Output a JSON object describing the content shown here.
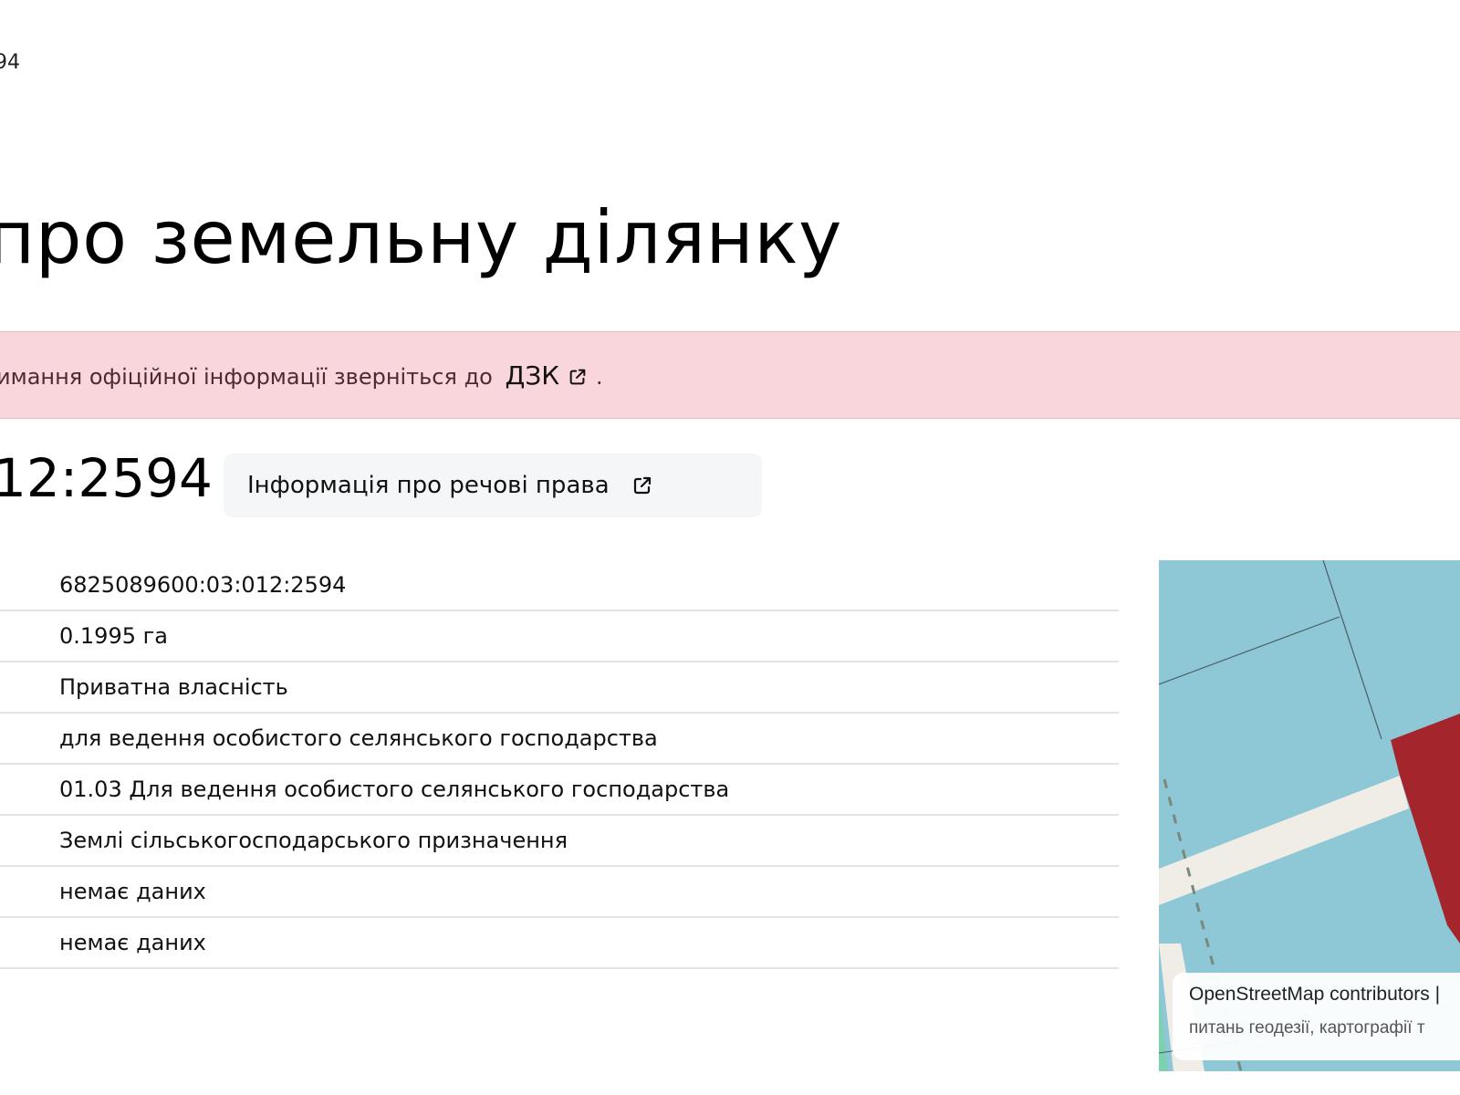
{
  "header": {
    "crumb_fragment": "94",
    "title": "про земельну ділянку"
  },
  "alert": {
    "text": "имання офіційної інформації зверніться до",
    "link_label": "ДЗК",
    "trailing": "."
  },
  "parcel": {
    "cadastral_fragment": "12:2594",
    "rights_button_label": "Інформація про речові права"
  },
  "details": {
    "values": [
      "6825089600:03:012:2594",
      "0.1995 га",
      "Приватна власність",
      "для ведення особистого селянського господарства",
      "01.03 Для ведення особистого селянського господарства",
      "Землі сільськогосподарського призначення",
      "немає даних",
      "немає даних"
    ]
  },
  "map": {
    "attribution_line1": "OpenStreetMap contributors |",
    "attribution_line2": "питань геодезії, картографії т",
    "colors": {
      "parcel_fill": "#a4262c",
      "background": "#8ec7d6",
      "road": "#efede6"
    }
  },
  "colors": {
    "alert_bg": "#f9d6dc",
    "divider": "#e2e3e4"
  }
}
